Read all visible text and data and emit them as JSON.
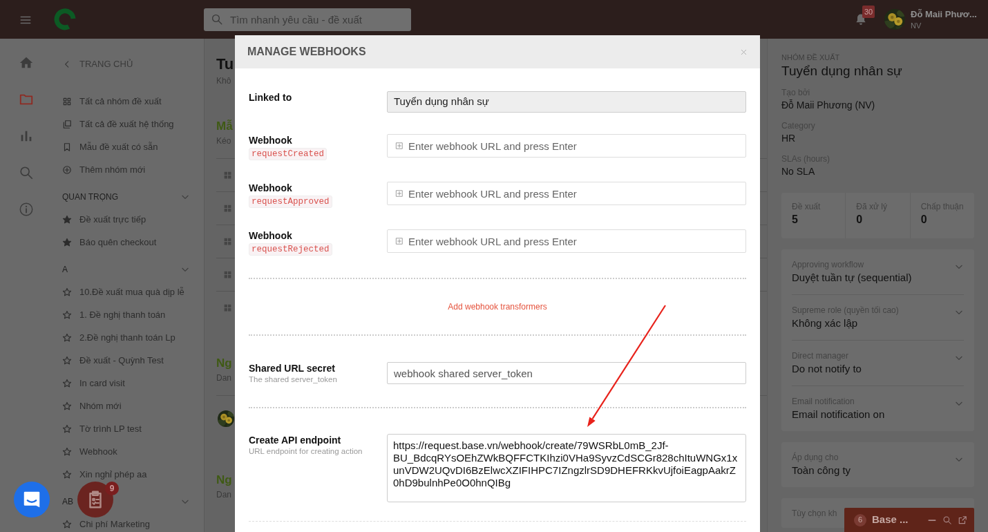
{
  "header": {
    "search_placeholder": "Tìm nhanh yêu cầu - đề xuất",
    "notification_count": "30",
    "user_name": "Đỗ Maii Phươ...",
    "user_role": "NV"
  },
  "rail": [
    {
      "kind": "home",
      "selected": false
    },
    {
      "kind": "folder",
      "selected": true
    },
    {
      "kind": "chart",
      "selected": false
    },
    {
      "kind": "search",
      "selected": false
    },
    {
      "kind": "info",
      "selected": false
    }
  ],
  "sidebar": {
    "back_label": "TRANG CHỦ",
    "links": [
      {
        "label": "Tất cả nhóm đề xuất"
      },
      {
        "label": "Tất cả đề xuất hệ thống"
      },
      {
        "label": "Mẫu đề xuất có sẵn"
      },
      {
        "label": "Thêm nhóm mới"
      }
    ],
    "sections": [
      {
        "title": "QUAN TRỌNG",
        "items": [
          {
            "label": "Đề xuất trực tiếp",
            "starred": true
          },
          {
            "label": "Báo quên checkout",
            "starred": true
          }
        ]
      },
      {
        "title": "A",
        "items": [
          {
            "label": "10.Đề xuất mua quà dịp lễ",
            "starred": false
          },
          {
            "label": "1. Đề nghị thanh toán",
            "starred": false
          },
          {
            "label": "2.Đề nghị thanh toán Lp",
            "starred": false
          },
          {
            "label": "Đề xuất - Quỳnh Test",
            "starred": false
          },
          {
            "label": "In card visit",
            "starred": false
          },
          {
            "label": "Nhóm mới",
            "starred": false
          },
          {
            "label": "Tờ trình LP test",
            "starred": false
          },
          {
            "label": "Webhook",
            "starred": false
          },
          {
            "label": "Xin nghỉ phép aa",
            "starred": false
          }
        ]
      },
      {
        "title": "AB",
        "items": [
          {
            "label": "Chi phí Marketing",
            "starred": false
          }
        ]
      }
    ]
  },
  "main": {
    "title": "Tu",
    "subtitle": "Khô",
    "groups": [
      {
        "heading": "Mẫ",
        "subtitle": "Kéo",
        "rows": [
          {
            "kind": "drag"
          },
          {
            "kind": "drag"
          },
          {
            "kind": "drag"
          },
          {
            "kind": "drag"
          },
          {
            "kind": "drag"
          }
        ]
      },
      {
        "heading": "Ng",
        "subtitle": "Dan",
        "rows": [
          {
            "kind": "avatar"
          }
        ]
      },
      {
        "heading": "Ng",
        "subtitle": "Dan"
      }
    ]
  },
  "right_panel": {
    "eyebrow": "NHÓM ĐỀ XUẤT",
    "title": "Tuyển dụng nhân sự",
    "fields": [
      {
        "label": "Tạo bởi",
        "value": "Đỗ Maii Phương (NV)"
      },
      {
        "label": "Category",
        "value": "HR"
      },
      {
        "label": "SLAs (hours)",
        "value": "No SLA"
      }
    ],
    "stats": [
      {
        "label": "Đề xuất",
        "value": "5"
      },
      {
        "label": "Đã xử lý",
        "value": "0"
      },
      {
        "label": "Chấp thuận",
        "value": "0"
      }
    ],
    "cards": [
      {
        "items": [
          {
            "label": "Approving workflow",
            "value": "Duyệt tuần tự (sequential)"
          },
          {
            "label": "Supreme role (quyền tối cao)",
            "value": "Không xác lập"
          },
          {
            "label": "Direct manager",
            "value": "Do not notify to"
          },
          {
            "label": "Email notification",
            "value": "Email notification on"
          }
        ]
      },
      {
        "items": [
          {
            "label": "Áp dụng cho",
            "value": "Toàn công ty"
          }
        ]
      },
      {
        "items": [
          {
            "label": "Tùy chọn kh"
          }
        ]
      }
    ]
  },
  "modal": {
    "title": "MANAGE WEBHOOKS",
    "linked_to": {
      "label": "Linked to",
      "value": "Tuyển dụng nhân sự"
    },
    "webhooks": [
      {
        "label": "Webhook",
        "event": "requestCreated",
        "placeholder": "Enter webhook URL and press Enter"
      },
      {
        "label": "Webhook",
        "event": "requestApproved",
        "placeholder": "Enter webhook URL and press Enter"
      },
      {
        "label": "Webhook",
        "event": "requestRejected",
        "placeholder": "Enter webhook URL and press Enter"
      }
    ],
    "transformers_link": "Add webhook transformers",
    "secret": {
      "label": "Shared URL secret",
      "hint": "The shared server_token",
      "value": "webhook shared server_token"
    },
    "endpoint": {
      "label": "Create API endpoint",
      "hint": "URL endpoint for creating action",
      "value": "https://request.base.vn/webhook/create/79WSRbL0mB_2Jf-BU_BdcqRYsOEhZWkBQFFCTKIhzi0VHa9SyvzCdSCGr828chItuWNGx1xunVDW2UQvDI6BzElwcXZIFIHPC7IZngzlrSD9DHEFRKkvUjfoiEagpAakrZ0hD9bulnhPe0O0hnQIBg"
    }
  },
  "annotations": [
    {
      "kind": "arrow"
    }
  ],
  "task_button": {
    "badge": "9"
  },
  "chat_bar": {
    "count": "6",
    "title": "Base ..."
  }
}
